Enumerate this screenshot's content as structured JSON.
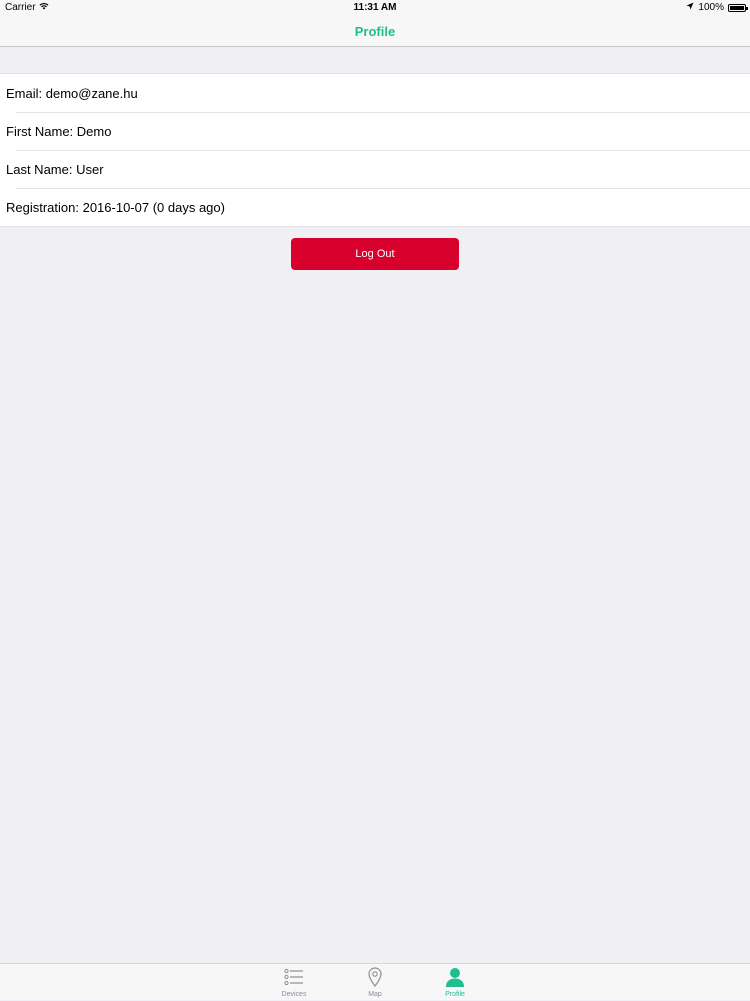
{
  "status_bar": {
    "carrier": "Carrier",
    "time": "11:31 AM",
    "battery": "100%"
  },
  "nav": {
    "title": "Profile"
  },
  "profile": {
    "rows": [
      {
        "text": "Email: demo@zane.hu"
      },
      {
        "text": "First Name: Demo"
      },
      {
        "text": "Last Name: User"
      },
      {
        "text": "Registration: 2016-10-07 (0 days ago)"
      }
    ]
  },
  "logout_button": {
    "label": "Log Out",
    "color": "#d8002c"
  },
  "tab_bar": {
    "tabs": [
      {
        "label": "Devices",
        "icon": "list-icon",
        "active": false
      },
      {
        "label": "Map",
        "icon": "map-pin-icon",
        "active": false
      },
      {
        "label": "Profile",
        "icon": "person-icon",
        "active": true
      }
    ],
    "accent": "#1dbf8f"
  }
}
